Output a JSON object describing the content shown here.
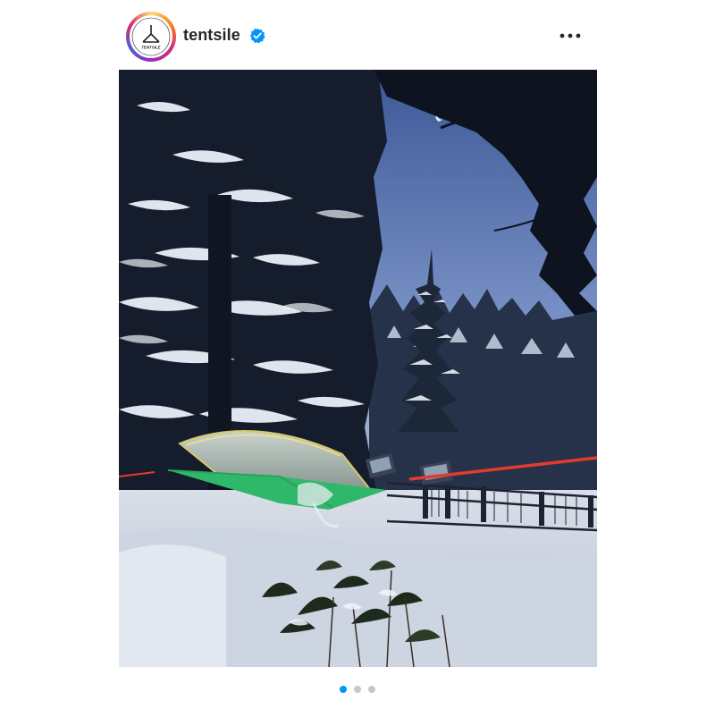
{
  "post": {
    "username": "tentsile",
    "verified": true,
    "avatar_icon": "tentsile-logo-icon",
    "avatar_logo_text": "TENTSILE",
    "more_icon": "more-options-icon",
    "image_alt": "Tentsile tree tent suspended in a snowy forest at dusk",
    "carousel": {
      "total": 3,
      "active_index": 0
    }
  },
  "colors": {
    "accent": "#0095f6",
    "tent_green": "#2fb86a",
    "strap_red": "#e53a2e",
    "sky": "#7d95c9"
  }
}
